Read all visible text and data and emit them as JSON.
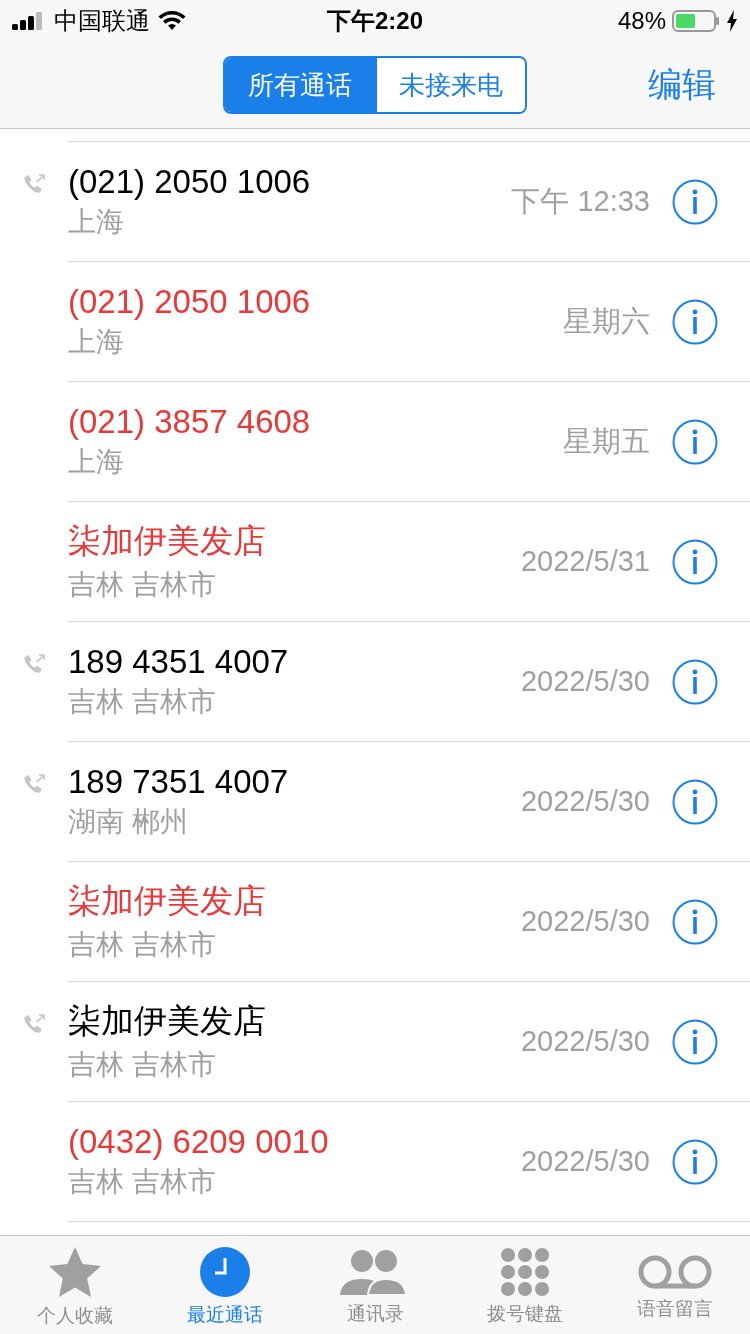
{
  "status_bar": {
    "carrier": "中国联通",
    "time": "下午2:20",
    "battery": "48%"
  },
  "segments": [
    {
      "label": "所有通话",
      "selected": true
    },
    {
      "label": "未接来电",
      "selected": false
    }
  ],
  "edit_button": "编辑",
  "calls": [
    {
      "name": "(021) 2050 1006",
      "location": "上海",
      "time": "下午 12:33",
      "missed": false,
      "outgoing": true
    },
    {
      "name": "(021) 2050 1006",
      "location": "上海",
      "time": "星期六",
      "missed": true,
      "outgoing": false
    },
    {
      "name": "(021) 3857 4608",
      "location": "上海",
      "time": "星期五",
      "missed": true,
      "outgoing": false
    },
    {
      "name": "柒加伊美发店",
      "location": "吉林 吉林市",
      "time": "2022/5/31",
      "missed": true,
      "outgoing": false
    },
    {
      "name": "189 4351 4007",
      "location": "吉林 吉林市",
      "time": "2022/5/30",
      "missed": false,
      "outgoing": true
    },
    {
      "name": "189 7351 4007",
      "location": "湖南 郴州",
      "time": "2022/5/30",
      "missed": false,
      "outgoing": true
    },
    {
      "name": "柒加伊美发店",
      "location": "吉林 吉林市",
      "time": "2022/5/30",
      "missed": true,
      "outgoing": false
    },
    {
      "name": "柒加伊美发店",
      "location": "吉林 吉林市",
      "time": "2022/5/30",
      "missed": false,
      "outgoing": true
    },
    {
      "name": "(0432) 6209 0010",
      "location": "吉林 吉林市",
      "time": "2022/5/30",
      "missed": true,
      "outgoing": false
    }
  ],
  "tab_bar": [
    {
      "label": "个人收藏",
      "kind": "favorites",
      "selected": false
    },
    {
      "label": "最近通话",
      "kind": "recents",
      "selected": true
    },
    {
      "label": "通讯录",
      "kind": "contacts",
      "selected": false
    },
    {
      "label": "拨号键盘",
      "kind": "keypad",
      "selected": false
    },
    {
      "label": "语音留言",
      "kind": "voicemail",
      "selected": false
    }
  ]
}
